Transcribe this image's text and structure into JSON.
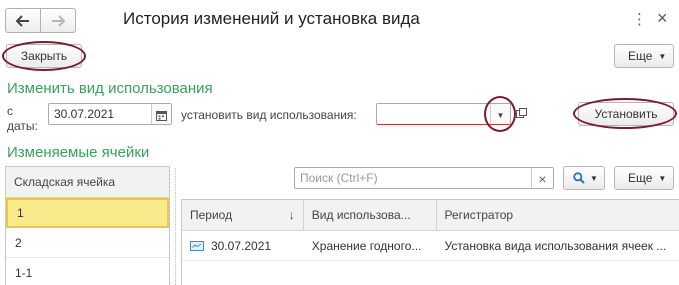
{
  "window": {
    "title": "История изменений и установка вида",
    "more_icon": "⋮",
    "close_icon": "×"
  },
  "toolbar": {
    "close_label": "Закрыть",
    "more_label": "Еще"
  },
  "change_section": {
    "title": "Изменить вид использования",
    "from_label_1": "с",
    "from_label_2": "даты:",
    "date_value": "30.07.2021",
    "usage_label": "установить вид использования:",
    "usage_value": "",
    "set_button": "Установить"
  },
  "cells_section": {
    "title": "Изменяемые ячейки",
    "column_header": "Складская ячейка",
    "rows": [
      "1",
      "2",
      "1-1"
    ],
    "selected_index": 0
  },
  "grid_toolbar": {
    "search_placeholder": "Поиск (Ctrl+F)",
    "clear_icon": "×",
    "more_label": "Еще"
  },
  "grid": {
    "columns": [
      "Период",
      "Вид использова...",
      "Регистратор"
    ],
    "sort_indicator": "↓",
    "rows": [
      {
        "period": "30.07.2021",
        "usage": "Хранение годного...",
        "registrator": "Установка вида использования ячеек ..."
      }
    ]
  },
  "colors": {
    "accent_green": "#3aa05a",
    "selection": "#f8e98a",
    "highlight_ellipse": "#7a1b2a"
  }
}
